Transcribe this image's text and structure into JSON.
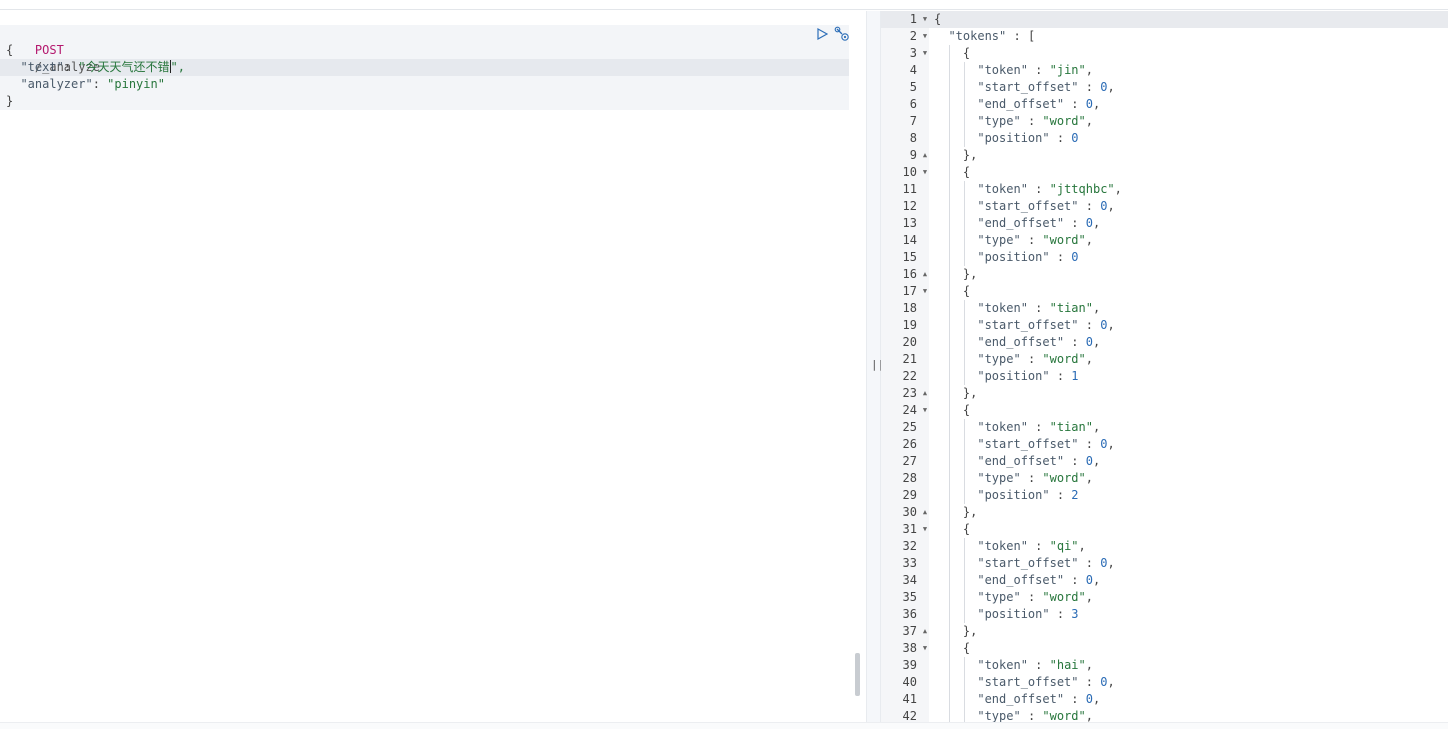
{
  "request": {
    "method": "POST",
    "path": "/_analyze",
    "open_brace": "{",
    "text_key": "\"text\"",
    "text_value_prefix": "\"今天天气还不错",
    "text_value_suffix": "\",",
    "analyzer_key": "\"analyzer\"",
    "analyzer_value": "\"pinyin\"",
    "close_brace": "}",
    "actions": {
      "run_icon": "play-icon",
      "settings_icon": "wrench-icon"
    }
  },
  "divider": {
    "handle": "||"
  },
  "response": {
    "line_numbers": [
      "1",
      "2",
      "3",
      "4",
      "5",
      "6",
      "7",
      "8",
      "9",
      "10",
      "11",
      "12",
      "13",
      "14",
      "15",
      "16",
      "17",
      "18",
      "19",
      "20",
      "21",
      "22",
      "23",
      "24",
      "25",
      "26",
      "27",
      "28",
      "29",
      "30",
      "31",
      "32",
      "33",
      "34",
      "35",
      "36",
      "37",
      "38",
      "39",
      "40",
      "41",
      "42"
    ],
    "lines": [
      "{",
      "  \"tokens\" : [",
      "    {",
      "      \"token\" : \"jin\",",
      "      \"start_offset\" : 0,",
      "      \"end_offset\" : 0,",
      "      \"type\" : \"word\",",
      "      \"position\" : 0",
      "    },",
      "    {",
      "      \"token\" : \"jttqhbc\",",
      "      \"start_offset\" : 0,",
      "      \"end_offset\" : 0,",
      "      \"type\" : \"word\",",
      "      \"position\" : 0",
      "    },",
      "    {",
      "      \"token\" : \"tian\",",
      "      \"start_offset\" : 0,",
      "      \"end_offset\" : 0,",
      "      \"type\" : \"word\",",
      "      \"position\" : 1",
      "    },",
      "    {",
      "      \"token\" : \"tian\",",
      "      \"start_offset\" : 0,",
      "      \"end_offset\" : 0,",
      "      \"type\" : \"word\",",
      "      \"position\" : 2",
      "    },",
      "    {",
      "      \"token\" : \"qi\",",
      "      \"start_offset\" : 0,",
      "      \"end_offset\" : 0,",
      "      \"type\" : \"word\",",
      "      \"position\" : 3",
      "    },",
      "    {",
      "      \"token\" : \"hai\",",
      "      \"start_offset\" : 0,",
      "      \"end_offset\" : 0,",
      "      \"type\" : \"word\","
    ],
    "fold_markers": {
      "1": "down",
      "2": "down",
      "3": "down",
      "9": "up",
      "10": "down",
      "16": "up",
      "17": "down",
      "23": "up",
      "24": "down",
      "30": "up",
      "31": "down",
      "37": "up",
      "38": "down"
    },
    "colors": {
      "key": "#4a5a6a",
      "string": "#27763c",
      "number": "#2a6bb5",
      "punct": "#444444"
    }
  }
}
